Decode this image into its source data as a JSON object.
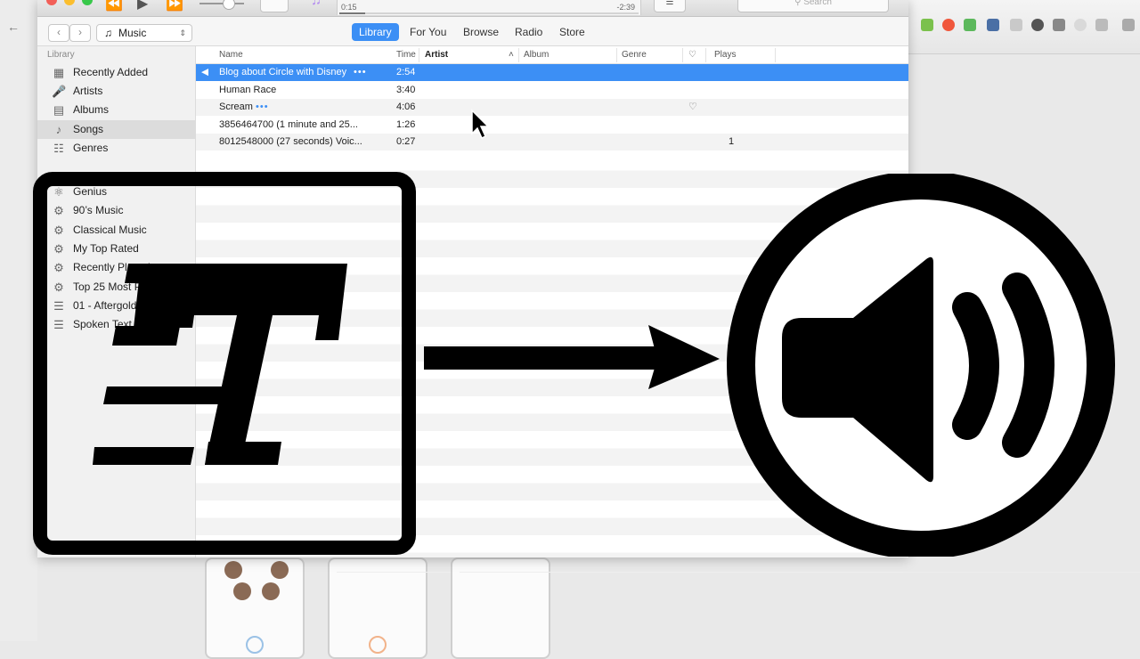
{
  "player": {
    "elapsed": "0:15",
    "remaining": "-2:39",
    "progress": 0.087,
    "search_placeholder": "Search"
  },
  "toolbar": {
    "media_type": "Music",
    "tabs": [
      {
        "label": "Library",
        "active": true
      },
      {
        "label": "For You",
        "active": false
      },
      {
        "label": "Browse",
        "active": false
      },
      {
        "label": "Radio",
        "active": false
      },
      {
        "label": "Store",
        "active": false
      }
    ]
  },
  "sidebar": {
    "library_heading": "Library",
    "library_items": [
      {
        "label": "Recently Added",
        "icon": "recently-added-icon"
      },
      {
        "label": "Artists",
        "icon": "artist-mic-icon"
      },
      {
        "label": "Albums",
        "icon": "album-icon"
      },
      {
        "label": "Songs",
        "icon": "music-note-icon",
        "selected": true
      },
      {
        "label": "Genres",
        "icon": "genres-icon"
      }
    ],
    "playlist_items": [
      {
        "label": "Genius",
        "icon": "genius-icon"
      },
      {
        "label": "90’s Music",
        "icon": "smart-playlist-gear-icon"
      },
      {
        "label": "Classical Music",
        "icon": "smart-playlist-gear-icon"
      },
      {
        "label": "My Top Rated",
        "icon": "smart-playlist-gear-icon"
      },
      {
        "label": "Recently Played",
        "icon": "smart-playlist-gear-icon"
      },
      {
        "label": "Top 25 Most Played",
        "icon": "smart-playlist-gear-icon"
      },
      {
        "label": "01 - Aftergold (feat  T...",
        "icon": "playlist-icon"
      },
      {
        "label": "Spoken Text",
        "icon": "playlist-icon"
      }
    ]
  },
  "songs": {
    "columns": {
      "name": "Name",
      "time": "Time",
      "artist": "Artist",
      "album": "Album",
      "genre": "Genre",
      "plays": "Plays"
    },
    "rows": [
      {
        "name": "Blog about Circle with Disney",
        "more": "•••",
        "time": "2:54",
        "plays": "",
        "loved": false,
        "playing": true
      },
      {
        "name": "Human Race",
        "more": "",
        "time": "3:40",
        "plays": "",
        "loved": false,
        "playing": false
      },
      {
        "name": "Scream",
        "more": "•••",
        "time": "4:06",
        "plays": "",
        "loved": true,
        "playing": false
      },
      {
        "name": "3856464700 (1 minute and 25...",
        "more": "",
        "time": "1:26",
        "plays": "",
        "loved": false,
        "playing": false
      },
      {
        "name": "8012548000 (27 seconds) Voic...",
        "more": "",
        "time": "0:27",
        "plays": "1",
        "loved": false,
        "playing": false
      }
    ]
  },
  "overlay": {
    "left_graphic": "text-document-icon",
    "middle_graphic": "right-arrow-icon",
    "right_graphic": "speaker-volume-icon"
  },
  "colors": {
    "accent": "#3c8ff5",
    "overlay": "#000000"
  }
}
